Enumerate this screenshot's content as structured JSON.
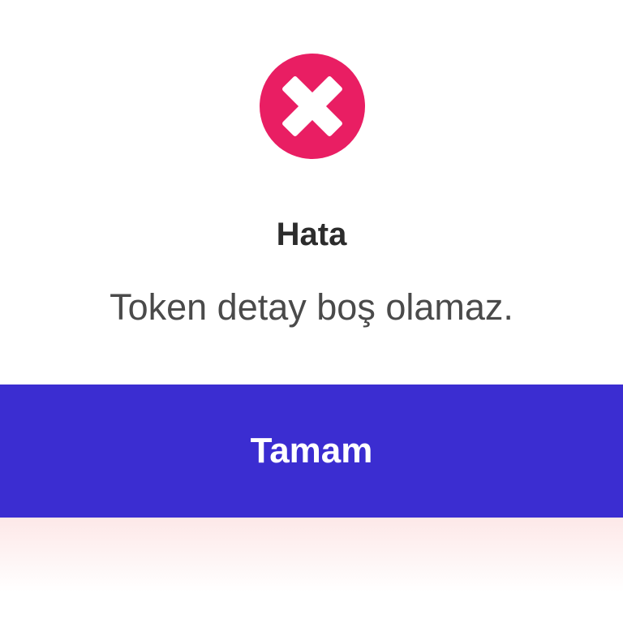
{
  "dialog": {
    "icon": "error-x-icon",
    "title": "Hata",
    "message": "Token detay boş olamaz.",
    "ok_label": "Tamam"
  },
  "colors": {
    "error": "#e91e63",
    "button": "#3b2dd1",
    "backdrop": "#fde8e8"
  }
}
